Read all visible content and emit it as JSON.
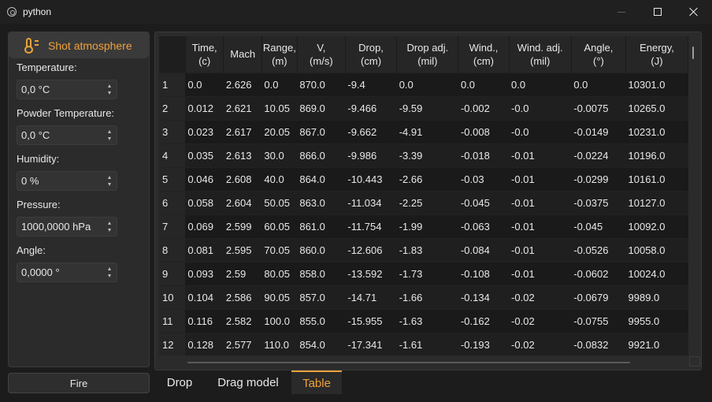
{
  "window": {
    "title": "python",
    "icon": "python-app-icon"
  },
  "sidebar": {
    "group_title": "Shot atmosphere",
    "group_icon": "thermometer-icon",
    "fields": [
      {
        "label": "Temperature:",
        "value": "0,0 °C"
      },
      {
        "label": "Powder Temperature:",
        "value": "0,0 °C"
      },
      {
        "label": "Humidity:",
        "value": "0 %"
      },
      {
        "label": "Pressure:",
        "value": "1000,0000 hPa"
      },
      {
        "label": "Angle:",
        "value": "0,0000 °"
      }
    ],
    "fire_label": "Fire"
  },
  "table": {
    "columns": [
      [
        "Time,",
        "(c)"
      ],
      [
        "Mach",
        ""
      ],
      [
        "Range,",
        "(m)"
      ],
      [
        "V,",
        "(m/s)"
      ],
      [
        "Drop,",
        "(cm)"
      ],
      [
        "Drop adj.",
        "(mil)"
      ],
      [
        "Wind.,",
        "(cm)"
      ],
      [
        "Wind. adj.",
        "(mil)"
      ],
      [
        "Angle,",
        "(°)"
      ],
      [
        "Energy,",
        "(J)"
      ]
    ],
    "rows": [
      [
        "1",
        "0.0",
        "2.626",
        "0.0",
        "870.0",
        "-9.4",
        "0.0",
        "0.0",
        "0.0",
        "0.0",
        "10301.0"
      ],
      [
        "2",
        "0.012",
        "2.621",
        "10.05",
        "869.0",
        "-9.466",
        "-9.59",
        "-0.002",
        "-0.0",
        "-0.0075",
        "10265.0"
      ],
      [
        "3",
        "0.023",
        "2.617",
        "20.05",
        "867.0",
        "-9.662",
        "-4.91",
        "-0.008",
        "-0.0",
        "-0.0149",
        "10231.0"
      ],
      [
        "4",
        "0.035",
        "2.613",
        "30.0",
        "866.0",
        "-9.986",
        "-3.39",
        "-0.018",
        "-0.01",
        "-0.0224",
        "10196.0"
      ],
      [
        "5",
        "0.046",
        "2.608",
        "40.0",
        "864.0",
        "-10.443",
        "-2.66",
        "-0.03",
        "-0.01",
        "-0.0299",
        "10161.0"
      ],
      [
        "6",
        "0.058",
        "2.604",
        "50.05",
        "863.0",
        "-11.034",
        "-2.25",
        "-0.045",
        "-0.01",
        "-0.0375",
        "10127.0"
      ],
      [
        "7",
        "0.069",
        "2.599",
        "60.05",
        "861.0",
        "-11.754",
        "-1.99",
        "-0.063",
        "-0.01",
        "-0.045",
        "10092.0"
      ],
      [
        "8",
        "0.081",
        "2.595",
        "70.05",
        "860.0",
        "-12.606",
        "-1.83",
        "-0.084",
        "-0.01",
        "-0.0526",
        "10058.0"
      ],
      [
        "9",
        "0.093",
        "2.59",
        "80.05",
        "858.0",
        "-13.592",
        "-1.73",
        "-0.108",
        "-0.01",
        "-0.0602",
        "10024.0"
      ],
      [
        "10",
        "0.104",
        "2.586",
        "90.05",
        "857.0",
        "-14.71",
        "-1.66",
        "-0.134",
        "-0.02",
        "-0.0679",
        "9989.0"
      ],
      [
        "11",
        "0.116",
        "2.582",
        "100.0",
        "855.0",
        "-15.955",
        "-1.63",
        "-0.162",
        "-0.02",
        "-0.0755",
        "9955.0"
      ],
      [
        "12",
        "0.128",
        "2.577",
        "110.0",
        "854.0",
        "-17.341",
        "-1.61",
        "-0.193",
        "-0.02",
        "-0.0832",
        "9921.0"
      ]
    ]
  },
  "tabs": [
    {
      "label": "Drop",
      "active": false
    },
    {
      "label": "Drag model",
      "active": false
    },
    {
      "label": "Table",
      "active": true
    }
  ],
  "colors": {
    "accent": "#e9a23b",
    "background": "#1c1c1c",
    "panel": "#2b2b2b"
  }
}
